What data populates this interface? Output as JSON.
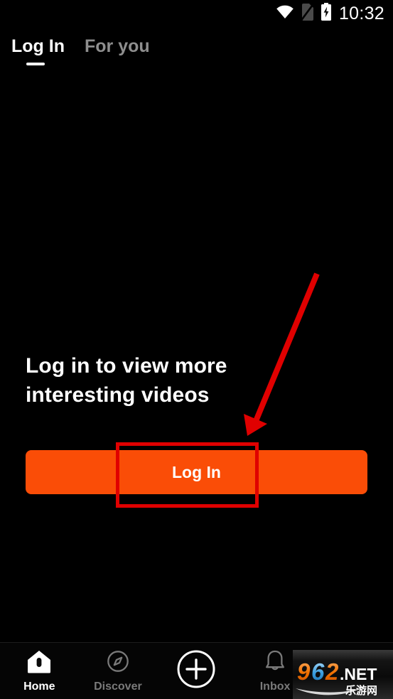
{
  "status_bar": {
    "time": "10:32",
    "icons": [
      {
        "name": "wifi-icon",
        "label": "wifi"
      },
      {
        "name": "sim-card-off-icon",
        "label": "no sim card"
      },
      {
        "name": "battery-charging-icon",
        "label": "battery charging"
      }
    ]
  },
  "top_tabs": {
    "items": [
      {
        "label": "Log In",
        "active": true
      },
      {
        "label": "For you",
        "active": false
      }
    ]
  },
  "main": {
    "headline": "Log in to view more interesting videos",
    "login_button_label": "Log In"
  },
  "bottom_nav": {
    "items": [
      {
        "label": "Home",
        "icon": "home-icon",
        "active": true
      },
      {
        "label": "Discover",
        "icon": "compass-icon",
        "active": false
      },
      {
        "label": "",
        "icon": "plus-circle-icon",
        "active": false
      },
      {
        "label": "Inbox",
        "icon": "bell-icon",
        "active": false
      },
      {
        "label": "",
        "icon": "profile-icon",
        "active": false
      }
    ]
  },
  "watermark": {
    "number": "962",
    "domain": ".NET",
    "chinese": "乐游网"
  },
  "annotations": {
    "arrow": {
      "name": "red-arrow-annotation",
      "color": "#e00000"
    },
    "rect": {
      "name": "red-highlight-rectangle",
      "color": "#e00000"
    }
  },
  "colors": {
    "background": "#000000",
    "accent_orange": "#fa4d07",
    "annotation_red": "#e00000",
    "active_text": "#ffffff",
    "inactive_text": "#7a7a7a"
  }
}
